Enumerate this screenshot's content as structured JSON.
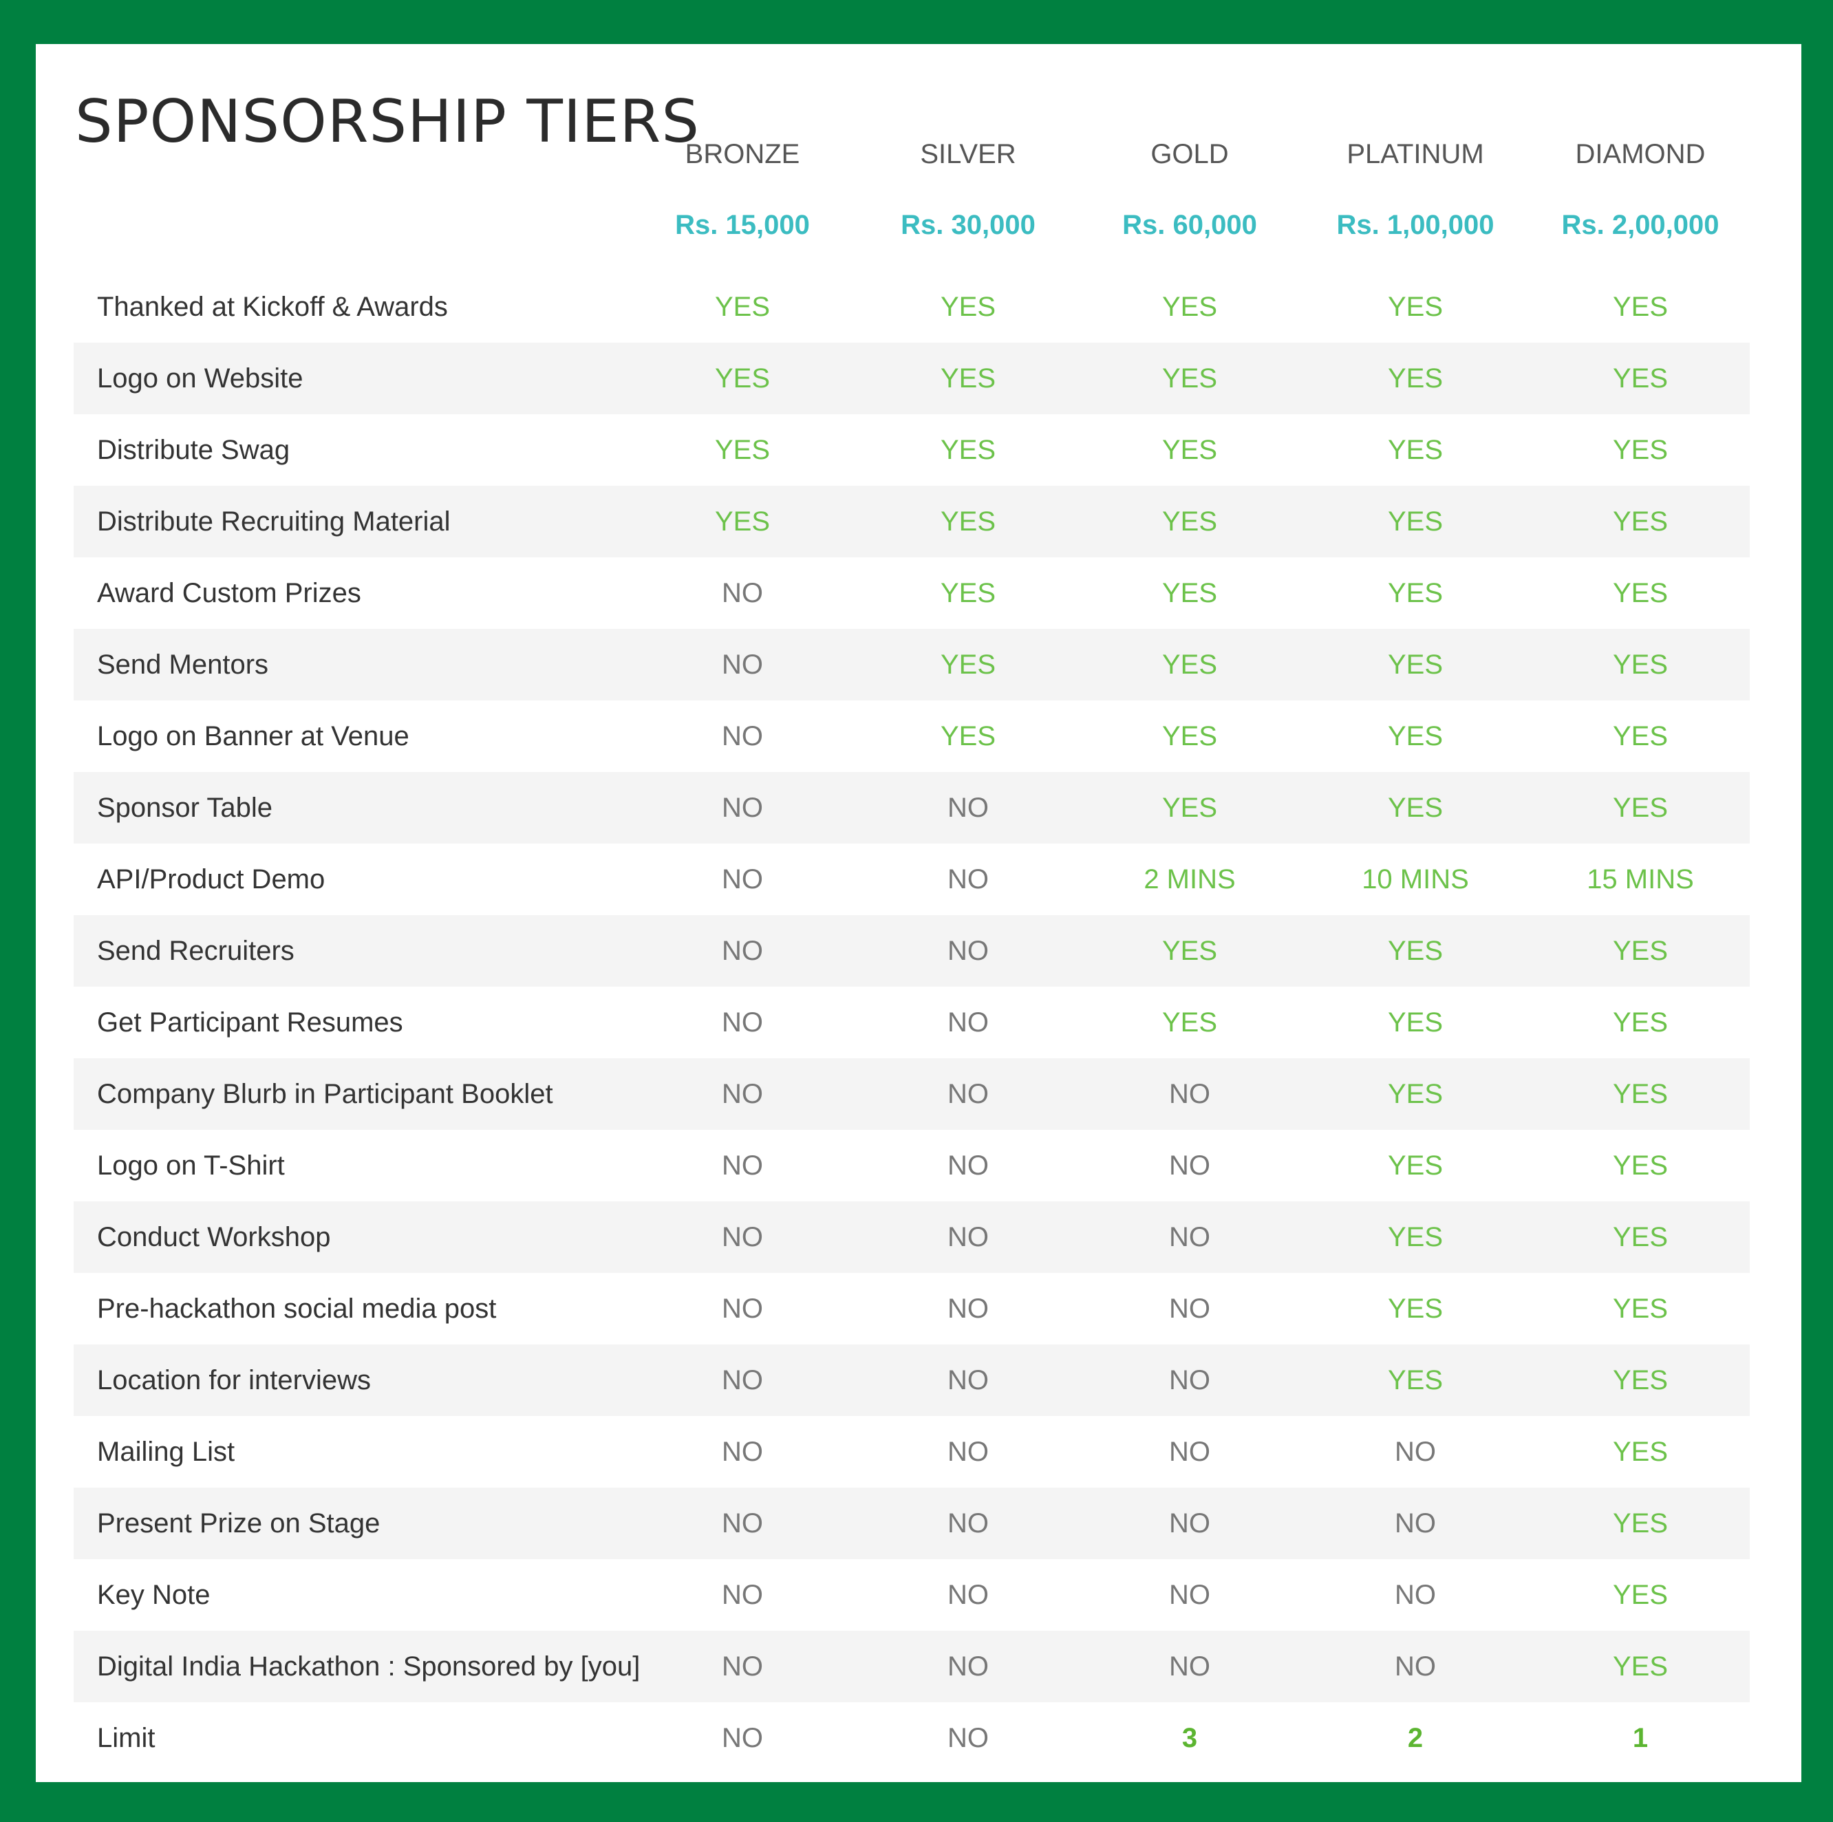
{
  "title": "SPONSORSHIP TIERS",
  "tiers": [
    {
      "name": "BRONZE",
      "price": "Rs. 15,000"
    },
    {
      "name": "SILVER",
      "price": "Rs. 30,000"
    },
    {
      "name": "GOLD",
      "price": "Rs. 60,000"
    },
    {
      "name": "PLATINUM",
      "price": "Rs. 1,00,000"
    },
    {
      "name": "DIAMOND",
      "price": "Rs. 2,00,000"
    }
  ],
  "colors": {
    "border": "#008040",
    "price": "#3bbcc1",
    "yes": "#6cc24a",
    "no": "#777777",
    "row_shade": "#f4f4f4"
  },
  "rows": [
    {
      "feature": "Thanked at Kickoff & Awards",
      "values": [
        "YES",
        "YES",
        "YES",
        "YES",
        "YES"
      ]
    },
    {
      "feature": "Logo on Website",
      "values": [
        "YES",
        "YES",
        "YES",
        "YES",
        "YES"
      ]
    },
    {
      "feature": "Distribute Swag",
      "values": [
        "YES",
        "YES",
        "YES",
        "YES",
        "YES"
      ]
    },
    {
      "feature": "Distribute Recruiting Material",
      "values": [
        "YES",
        "YES",
        "YES",
        "YES",
        "YES"
      ]
    },
    {
      "feature": "Award Custom Prizes",
      "values": [
        "NO",
        "YES",
        "YES",
        "YES",
        "YES"
      ]
    },
    {
      "feature": "Send Mentors",
      "values": [
        "NO",
        "YES",
        "YES",
        "YES",
        "YES"
      ]
    },
    {
      "feature": "Logo on Banner at Venue",
      "values": [
        "NO",
        "YES",
        "YES",
        "YES",
        "YES"
      ]
    },
    {
      "feature": "Sponsor Table",
      "values": [
        "NO",
        "NO",
        "YES",
        "YES",
        "YES"
      ]
    },
    {
      "feature": "API/Product Demo",
      "values": [
        "NO",
        "NO",
        "2 MINS",
        "10 MINS",
        "15 MINS"
      ]
    },
    {
      "feature": "Send Recruiters",
      "values": [
        "NO",
        "NO",
        "YES",
        "YES",
        "YES"
      ]
    },
    {
      "feature": "Get Participant Resumes",
      "values": [
        "NO",
        "NO",
        "YES",
        "YES",
        "YES"
      ]
    },
    {
      "feature": "Company Blurb in Participant Booklet",
      "values": [
        "NO",
        "NO",
        "NO",
        "YES",
        "YES"
      ]
    },
    {
      "feature": "Logo on T-Shirt",
      "values": [
        "NO",
        "NO",
        "NO",
        "YES",
        "YES"
      ]
    },
    {
      "feature": "Conduct Workshop",
      "values": [
        "NO",
        "NO",
        "NO",
        "YES",
        "YES"
      ]
    },
    {
      "feature": "Pre-hackathon social media post",
      "values": [
        "NO",
        "NO",
        "NO",
        "YES",
        "YES"
      ]
    },
    {
      "feature": "Location for interviews",
      "values": [
        "NO",
        "NO",
        "NO",
        "YES",
        "YES"
      ]
    },
    {
      "feature": "Mailing List",
      "values": [
        "NO",
        "NO",
        "NO",
        "NO",
        "YES"
      ]
    },
    {
      "feature": "Present Prize on Stage",
      "values": [
        "NO",
        "NO",
        "NO",
        "NO",
        "YES"
      ]
    },
    {
      "feature": "Key Note",
      "values": [
        "NO",
        "NO",
        "NO",
        "NO",
        "YES"
      ]
    },
    {
      "feature": "Digital India Hackathon : Sponsored by [you]",
      "values": [
        "NO",
        "NO",
        "NO",
        "NO",
        "YES"
      ]
    },
    {
      "feature": "Limit",
      "values": [
        "NO",
        "NO",
        "3",
        "2",
        "1"
      ]
    }
  ]
}
